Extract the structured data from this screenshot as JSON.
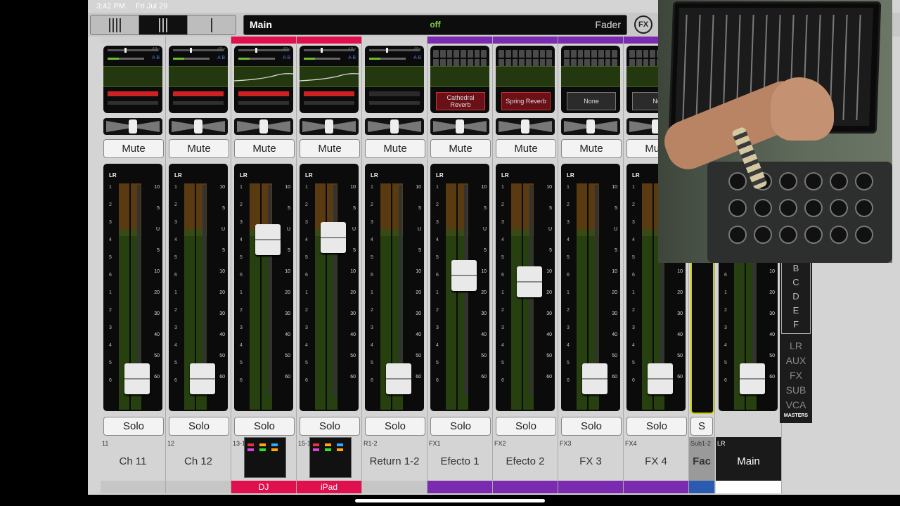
{
  "status": {
    "time": "3:42 PM",
    "date": "Fri Jul 29"
  },
  "topbar": {
    "main_label": "Main",
    "state": "off",
    "mode": "Fader",
    "fx_label": "FX"
  },
  "strips": [
    {
      "num": "11",
      "name": "Ch 11",
      "color": "#d0d0d0",
      "mute": "Mute",
      "solo": "Solo",
      "fader_level": 0.08,
      "kind": "channel",
      "eq_curve": false,
      "dyn": true
    },
    {
      "num": "12",
      "name": "Ch 12",
      "color": "#d0d0d0",
      "mute": "Mute",
      "solo": "Solo",
      "fader_level": 0.08,
      "kind": "channel",
      "eq_curve": false,
      "dyn": true
    },
    {
      "num": "13-14",
      "name": "DJ",
      "color": "#e0104f",
      "mute": "Mute",
      "solo": "Solo",
      "fader_level": 0.74,
      "kind": "channel",
      "eq_curve": true,
      "dyn": true,
      "thumb": true,
      "bottom": "DJ"
    },
    {
      "num": "15-16",
      "name": "iPad",
      "color": "#e0104f",
      "mute": "Mute",
      "solo": "Solo",
      "fader_level": 0.75,
      "kind": "channel",
      "eq_curve": true,
      "dyn": true,
      "thumb": true,
      "bottom": "iPad"
    },
    {
      "num": "R1-2",
      "name": "Return 1-2",
      "color": "#d0d0d0",
      "mute": "Mute",
      "solo": "Solo",
      "fader_level": 0.08,
      "kind": "channel",
      "eq_curve": false,
      "dyn": false
    },
    {
      "num": "FX1",
      "name": "Efecto 1",
      "color": "#7a2bb0",
      "mute": "Mute",
      "solo": "Solo",
      "fader_level": 0.57,
      "kind": "fx",
      "fx": "Cathedral Reverb",
      "fx_red": true
    },
    {
      "num": "FX2",
      "name": "Efecto 2",
      "color": "#7a2bb0",
      "mute": "Mute",
      "solo": "Solo",
      "fader_level": 0.54,
      "kind": "fx",
      "fx": "Spring Reverb",
      "fx_red": true
    },
    {
      "num": "FX3",
      "name": "FX 3",
      "color": "#7a2bb0",
      "mute": "Mute",
      "solo": "Solo",
      "fader_level": 0.08,
      "kind": "fx",
      "fx": "None",
      "fx_red": false
    },
    {
      "num": "FX4",
      "name": "FX 4",
      "color": "#7a2bb0",
      "mute": "Mute",
      "solo": "Solo",
      "fader_level": 0.08,
      "kind": "fx",
      "fx": "No",
      "fx_red": false
    }
  ],
  "sub": {
    "num": "Sub1-2",
    "name": "Fac",
    "solo": "S"
  },
  "main": {
    "num": "LR",
    "name": "Main"
  },
  "masters": {
    "letters": [
      "B",
      "C",
      "D",
      "E",
      "F"
    ],
    "groups": [
      "LR",
      "AUX",
      "FX",
      "SUB",
      "VCA"
    ],
    "label": "MASTERS"
  },
  "scale_right": [
    "10",
    "5",
    "U",
    "5",
    "10",
    "20",
    "30",
    "40",
    "50",
    "60"
  ],
  "scale_left": [
    "1",
    "2",
    "3",
    "4",
    "5",
    "6",
    "1",
    "2",
    "3",
    "4",
    "5",
    "6"
  ]
}
